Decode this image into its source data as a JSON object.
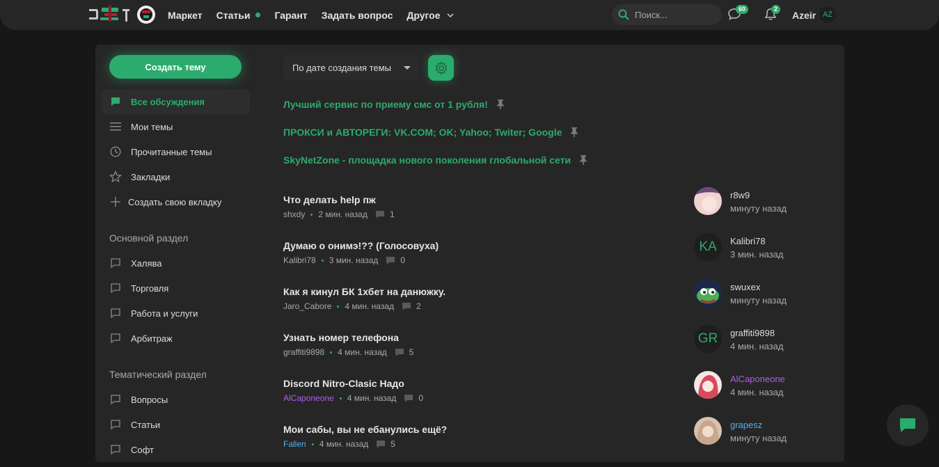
{
  "header": {
    "nav": [
      {
        "label": "Маркет"
      },
      {
        "label": "Статьи"
      },
      {
        "label": "Гарант"
      },
      {
        "label": "Задать вопрос"
      },
      {
        "label": "Другое"
      }
    ],
    "search_placeholder": "Поиск...",
    "messages_count": "60",
    "alerts_count": "2",
    "username": "Azeir",
    "avatar_initials": "AZ"
  },
  "sidebar": {
    "create_label": "Создать тему",
    "items": [
      {
        "label": "Все обсуждения"
      },
      {
        "label": "Мои темы"
      },
      {
        "label": "Прочитанные темы"
      },
      {
        "label": "Закладки"
      },
      {
        "label": "Создать свою вкладку"
      }
    ],
    "section1": {
      "title": "Основной раздел",
      "items": [
        {
          "label": "Халява"
        },
        {
          "label": "Торговля"
        },
        {
          "label": "Работа и услуги"
        },
        {
          "label": "Арбитраж"
        }
      ]
    },
    "section2": {
      "title": "Тематический раздел",
      "items": [
        {
          "label": "Вопросы"
        },
        {
          "label": "Статьи"
        },
        {
          "label": "Софт"
        }
      ]
    }
  },
  "main": {
    "sort_label": "По дате создания темы",
    "pinned": [
      {
        "title": "Лучший сервис по приему смс от 1 рубля!"
      },
      {
        "title": "ПРОКСИ и АВТОРЕГИ: VK.COM; OK; Yahoo; Twiter; Google"
      },
      {
        "title": "SkyNetZone - площадка нового поколения глобальной сети"
      }
    ],
    "threads": [
      {
        "title": "Что делать help пж",
        "author": "shxdy",
        "time": "2 мин. назад",
        "replies": "1",
        "last_user": "r8w9",
        "last_time": "минуту назад",
        "avatar_initials": ""
      },
      {
        "title": "Думаю о онимэ!?? (Голосовуха)",
        "author": "Kalibri78",
        "time": "3 мин. назад",
        "replies": "0",
        "last_user": "Kalibri78",
        "last_time": "3 мин. назад",
        "avatar_initials": "KA"
      },
      {
        "title": "Как я кинул БК 1хбет на данюжку.",
        "author": "Jaro_Cabore",
        "time": "4 мин. назад",
        "replies": "2",
        "last_user": "swuxex",
        "last_time": "минуту назад",
        "avatar_initials": ""
      },
      {
        "title": "Узнать номер телефона",
        "author": "graffiti9898",
        "time": "4 мин. назад",
        "replies": "5",
        "last_user": "graffiti9898",
        "last_time": "4 мин. назад",
        "avatar_initials": "GR"
      },
      {
        "title": "Discord Nitro-Clasic Надо",
        "author": "AlCaponeone",
        "time": "4 мин. назад",
        "replies": "0",
        "last_user": "AlCaponeone",
        "last_time": "4 мин. назад",
        "avatar_initials": ""
      },
      {
        "title": "Мои сабы, вы не ебанулись ещё?",
        "author": "Fallen",
        "time": "4 мин. назад",
        "replies": "5",
        "last_user": "grapesz",
        "last_time": "минуту назад",
        "avatar_initials": ""
      }
    ]
  },
  "colors": {
    "accent": "#2bab6d",
    "purple_user": "#b05ee6",
    "blue_user": "#4fb1f2"
  }
}
